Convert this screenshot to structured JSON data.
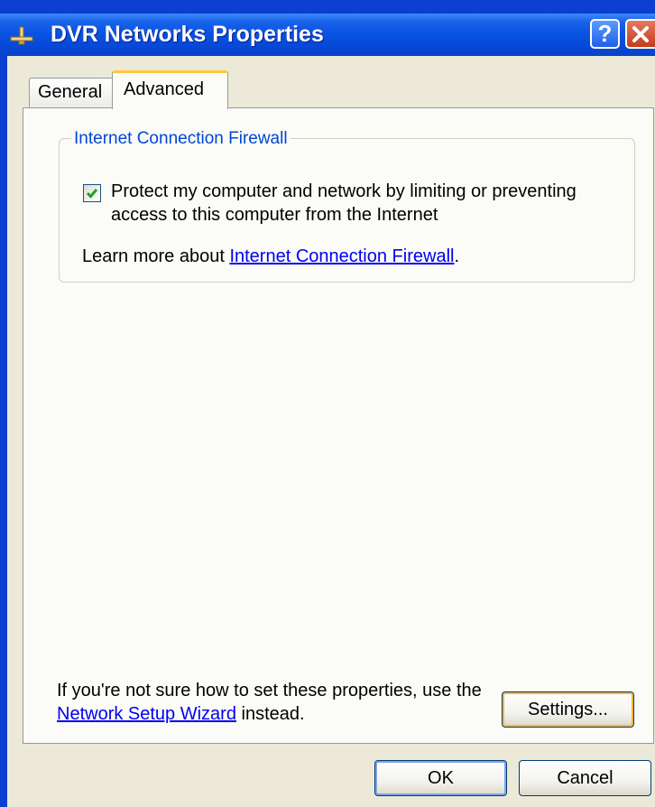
{
  "window": {
    "title": "DVR Networks Properties",
    "help_label": "?",
    "icon": "network-connection-icon",
    "close_icon": "close-icon"
  },
  "tabs": [
    {
      "label": "General",
      "selected": false
    },
    {
      "label": "Advanced",
      "selected": true
    }
  ],
  "firewall": {
    "group_title": "Internet Connection Firewall",
    "checkbox_checked": true,
    "checkbox_label": "Protect my computer and network by limiting or preventing access to this computer from the Internet",
    "learn_more_prefix": "Learn more about ",
    "learn_more_link": "Internet Connection Firewall",
    "learn_more_suffix": "."
  },
  "hint": {
    "prefix": "If you're not sure how to set these properties, use the ",
    "link": "Network Setup Wizard",
    "suffix": " instead."
  },
  "buttons": {
    "settings": "Settings...",
    "ok": "OK",
    "cancel": "Cancel"
  },
  "colors": {
    "titlebar": "#0a54e3",
    "dialog_face": "#ece9d8",
    "group_title": "#0046d5",
    "link": "#0000ee",
    "tab_highlight": "#ffc83c"
  }
}
